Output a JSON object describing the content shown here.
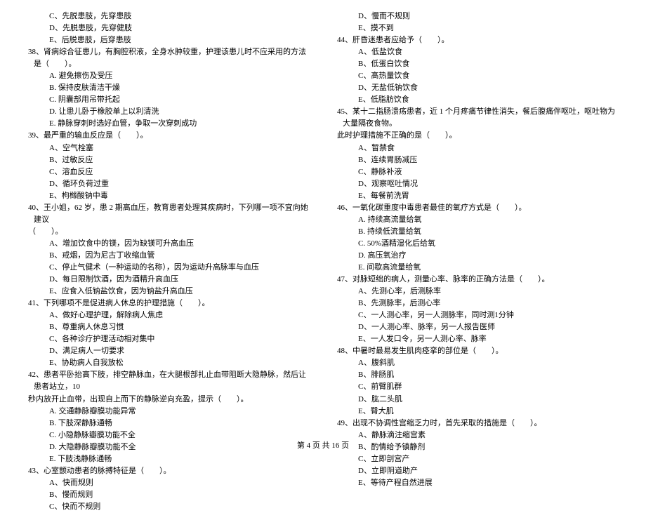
{
  "left": {
    "q37_opts": [
      "C、先脱患肢，先穿患肢",
      "D、先脱患肢，先穿健肢",
      "E、后脱患肢，后穿患肢"
    ],
    "q38": "38、肾病综合征患儿，有胸腔积液，全身水肿较重，护理该患儿时不应采用的方法是（　　）。",
    "q38_opts": [
      "A. 避免擦伤及受压",
      "B. 保持皮肤清洁干燥",
      "C. 阴囊部用吊带托起",
      "D. 让患儿卧于橡胶单上以利清洗",
      "E. 静脉穿刺时选好血管，争取一次穿刺成功"
    ],
    "q39": "39、最严重的输血反应是（　　）。",
    "q39_opts": [
      "A、空气栓塞",
      "B、过敏反应",
      "C、溶血反应",
      "D、循环负荷过重",
      "E、枸橼酸钠中毒"
    ],
    "q40": "40、王小姐，62 岁，患 2 期高血压，教育患者处理其疾病时，下列哪一项不宜向她建议",
    "q40_cont": "（　　）。",
    "q40_opts": [
      "A、增加饮食中的镁，因为缺镁可升高血压",
      "B、戒烟，因为尼古丁收缩血管",
      "C、停止气健术（一种运动的名称），因为运动升高脉率与血压",
      "D、每日限制饮酒，因为酒精升高血压",
      "E、应食入低钠盐饮食，因为钠盐升高血压"
    ],
    "q41": "41、下列哪项不是促进病人休息的护理措施（　　）。",
    "q41_opts": [
      "A、做好心理护理，解除病人焦虑",
      "B、尊重病人休息习惯",
      "C、各种诊疗护理活动相对集中",
      "D、满足病人一切要求",
      "E、协助病人自我放松"
    ],
    "q42": "42、患者平卧抬高下肢，排空静脉血，在大腿根部扎止血带阻断大隐静脉，然后让患者站立，10",
    "q42_cont": "秒内放开止血带，出现自上而下的静脉逆向充盈，提示（　　）。",
    "q42_opts": [
      "A. 交通静脉瓣膜功能异常",
      "B. 下肢深静脉通畅",
      "C. 小隐静脉瓣膜功能不全",
      "D. 大隐静脉瓣膜功能不全",
      "E. 下肢浅静脉通畅"
    ],
    "q43": "43、心室颤动患者的脉搏特征是（　　）。",
    "q43_opts": [
      "A、快而规则",
      "B、慢而规则",
      "C、快而不规则"
    ]
  },
  "right": {
    "q43_opts": [
      "D、慢而不规则",
      "E、摸不到"
    ],
    "q44": "44、肝昏迷患者应给予（　　）。",
    "q44_opts": [
      "A、低盐饮食",
      "B、低蛋白饮食",
      "C、高热量饮食",
      "D、无盐低钠饮食",
      "E、低脂肪饮食"
    ],
    "q45": "45、某十二指肠溃疡患者，近 1 个月疼痛节律性消失，餐后腹痛伴呕吐，呕吐物为大量隔夜食物。",
    "q45_cont": "此时护理措施不正确的是（　　）。",
    "q45_opts": [
      "A、暂禁食",
      "B、连续胃肠减压",
      "C、静脉补液",
      "D、观察呕吐情况",
      "E、每餐前洗胃"
    ],
    "q46": "46、一氧化碳重度中毒患者最佳的氧疗方式是（　　）。",
    "q46_opts": [
      "A. 持续高流量给氧",
      "B. 持续低流量给氧",
      "C. 50%酒精湿化后给氧",
      "D. 高压氧治疗",
      "E. 间歇高流量给氧"
    ],
    "q47": "47、对脉短绌的病人，测量心率、脉率的正确方法是（　　）。",
    "q47_opts": [
      "A、先测心率，后测脉率",
      "B、先测脉率，后测心率",
      "C、一人测心率，另一人测脉率，同时测1分钟",
      "D、一人测心率、脉率，另一人报告医师",
      "E、一人发口令，另一人测心率、脉率"
    ],
    "q48": "48、中暑时最易发生肌肉痉挛的部位是（　　）。",
    "q48_opts": [
      "A、腹斜肌",
      "B、腓肠肌",
      "C、前臂肌群",
      "D、肱二头肌",
      "E、臀大肌"
    ],
    "q49": "49、出现不协调性宫缩乏力时，首先采取的措施是（　　）。",
    "q49_opts": [
      "A、静脉滴注缩宫素",
      "B、酌情给予镇静剂",
      "C、立即剖宫产",
      "D、立即阴道助产",
      "E、等待产程自然进展"
    ]
  },
  "footer": "第 4 页 共 16 页"
}
